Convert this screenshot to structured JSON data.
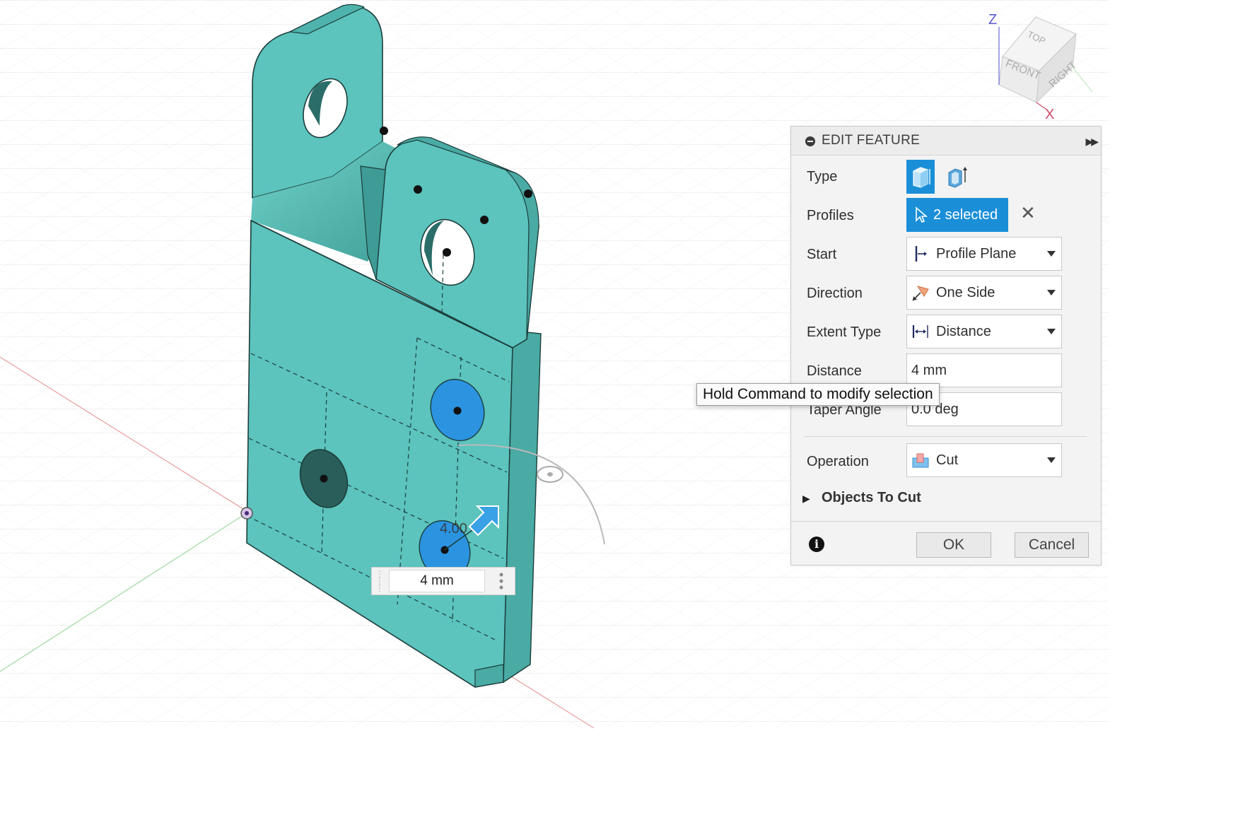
{
  "viewcube": {
    "faces": {
      "top": "TOP",
      "front": "FRONT",
      "right": "RIGHT"
    },
    "axes": {
      "z": "Z",
      "x": "X"
    }
  },
  "viewport": {
    "dimension_label": "4.00",
    "dimension_input_value": "4 mm",
    "model_color": "#5cc3bd",
    "selected_profile_color": "#2b93e0"
  },
  "panel": {
    "title": "EDIT FEATURE",
    "rows": {
      "type": {
        "label": "Type"
      },
      "profiles": {
        "label": "Profiles",
        "value": "2 selected"
      },
      "start": {
        "label": "Start",
        "value": "Profile Plane"
      },
      "direction": {
        "label": "Direction",
        "value": "One Side"
      },
      "extent_type": {
        "label": "Extent Type",
        "value": "Distance"
      },
      "distance": {
        "label": "Distance",
        "value": "4 mm"
      },
      "taper_angle": {
        "label": "Taper Angle",
        "value": "0.0 deg"
      },
      "operation": {
        "label": "Operation",
        "value": "Cut"
      },
      "objects_to_cut": {
        "label": "Objects To Cut"
      }
    },
    "buttons": {
      "ok": "OK",
      "cancel": "Cancel"
    },
    "accent_color": "#1a8fd8"
  },
  "tooltip": {
    "text": "Hold Command to modify selection"
  }
}
